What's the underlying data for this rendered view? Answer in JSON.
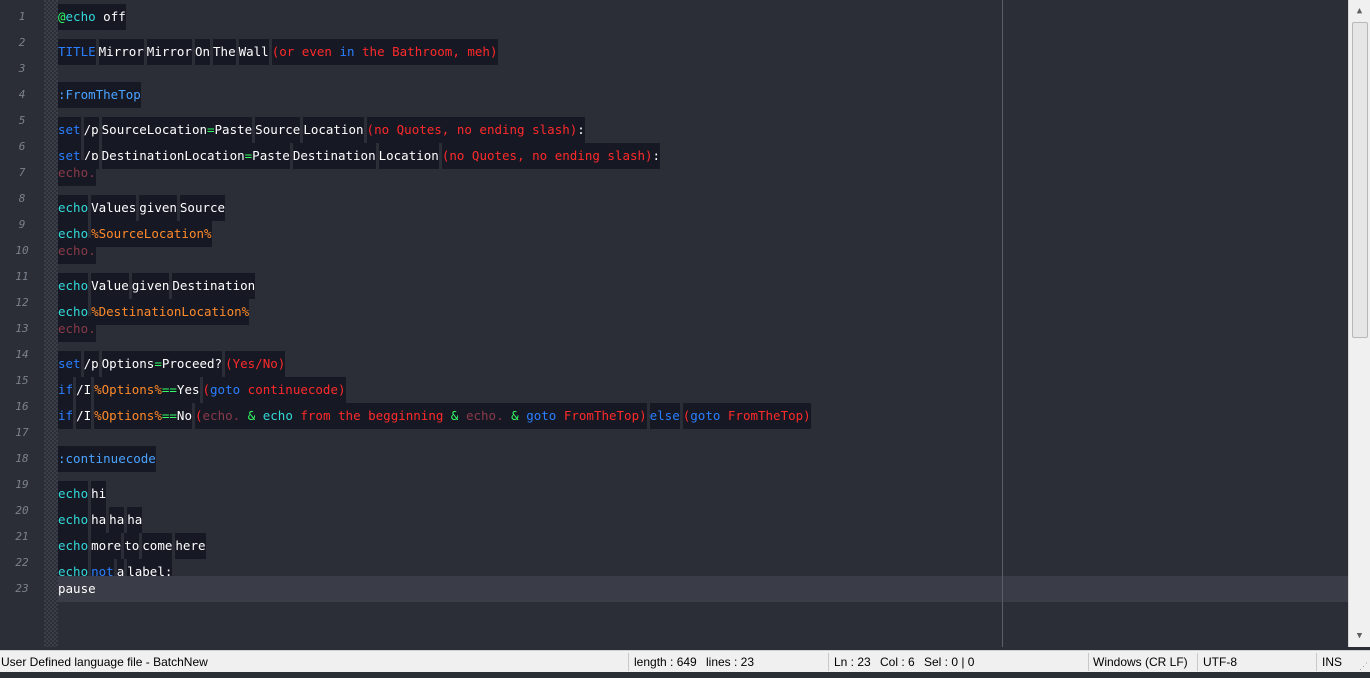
{
  "colors": {
    "background": "#2b2e37",
    "token_background": "#161824",
    "keyword_blue": "#2a7fff",
    "command_cyan": "#33d9d9",
    "string_red": "#ff2a2a",
    "variable_orange": "#ff8a2a",
    "operator_green": "#33ff66",
    "comment_maroon": "#8a3a48",
    "label_blue": "#4aa3ff",
    "text_white": "#ffffff"
  },
  "line_numbers": [
    "1",
    "2",
    "3",
    "4",
    "5",
    "6",
    "7",
    "8",
    "9",
    "10",
    "11",
    "12",
    "13",
    "14",
    "15",
    "16",
    "17",
    "18",
    "19",
    "20",
    "21",
    "22",
    "23"
  ],
  "code_lines": [
    [
      {
        "t": "@",
        "c": "#33ff66"
      },
      {
        "t": "echo",
        "c": "#33d9d9"
      },
      {
        "t": " off",
        "c": "#ffffff"
      }
    ],
    [
      {
        "t": "TITLE",
        "c": "#2a7fff"
      },
      {
        "s": 1
      },
      {
        "t": "Mirror",
        "c": "#ffffff"
      },
      {
        "s": 1
      },
      {
        "t": "Mirror",
        "c": "#ffffff"
      },
      {
        "s": 1
      },
      {
        "t": "On",
        "c": "#ffffff"
      },
      {
        "s": 1
      },
      {
        "t": "The",
        "c": "#ffffff"
      },
      {
        "s": 1
      },
      {
        "t": "Wall",
        "c": "#ffffff"
      },
      {
        "s": 1
      },
      {
        "t": "(or even ",
        "c": "#ff2a2a"
      },
      {
        "t": "in",
        "c": "#2a7fff"
      },
      {
        "t": " the Bathroom, meh)",
        "c": "#ff2a2a"
      }
    ],
    [],
    [
      {
        "t": ":FromTheTop",
        "c": "#4aa3ff"
      }
    ],
    [
      {
        "t": "set",
        "c": "#2a7fff"
      },
      {
        "s": 1
      },
      {
        "t": "/p",
        "c": "#ffffff"
      },
      {
        "s": 1
      },
      {
        "t": "SourceLocation",
        "c": "#ffffff"
      },
      {
        "t": "=",
        "c": "#33ff66"
      },
      {
        "t": "Paste",
        "c": "#ffffff"
      },
      {
        "s": 1
      },
      {
        "t": "Source",
        "c": "#ffffff"
      },
      {
        "s": 1
      },
      {
        "t": "Location",
        "c": "#ffffff"
      },
      {
        "s": 1
      },
      {
        "t": "(no Quotes, no ending slash)",
        "c": "#ff2a2a"
      },
      {
        "t": ":",
        "c": "#ffffff"
      }
    ],
    [
      {
        "t": "set",
        "c": "#2a7fff"
      },
      {
        "s": 1
      },
      {
        "t": "/p",
        "c": "#ffffff"
      },
      {
        "s": 1
      },
      {
        "t": "DestinationLocation",
        "c": "#ffffff"
      },
      {
        "t": "=",
        "c": "#33ff66"
      },
      {
        "t": "Paste",
        "c": "#ffffff"
      },
      {
        "s": 1
      },
      {
        "t": "Destination",
        "c": "#ffffff"
      },
      {
        "s": 1
      },
      {
        "t": "Location",
        "c": "#ffffff"
      },
      {
        "s": 1
      },
      {
        "t": "(no Quotes, no ending slash)",
        "c": "#ff2a2a"
      },
      {
        "t": ":",
        "c": "#ffffff"
      }
    ],
    [
      {
        "t": "echo.",
        "c": "#8a3a48"
      }
    ],
    [
      {
        "t": "echo",
        "c": "#33d9d9"
      },
      {
        "s": 1
      },
      {
        "t": "Values",
        "c": "#ffffff"
      },
      {
        "s": 1
      },
      {
        "t": "given",
        "c": "#ffffff"
      },
      {
        "s": 1
      },
      {
        "t": "Source",
        "c": "#ffffff"
      }
    ],
    [
      {
        "t": "echo",
        "c": "#33d9d9"
      },
      {
        "s": 1
      },
      {
        "t": "%SourceLocation%",
        "c": "#ff8a2a"
      }
    ],
    [
      {
        "t": "echo.",
        "c": "#8a3a48"
      }
    ],
    [
      {
        "t": "echo",
        "c": "#33d9d9"
      },
      {
        "s": 1
      },
      {
        "t": "Value",
        "c": "#ffffff"
      },
      {
        "s": 1
      },
      {
        "t": "given",
        "c": "#ffffff"
      },
      {
        "s": 1
      },
      {
        "t": "Destination",
        "c": "#ffffff"
      }
    ],
    [
      {
        "t": "echo",
        "c": "#33d9d9"
      },
      {
        "s": 1
      },
      {
        "t": "%DestinationLocation%",
        "c": "#ff8a2a"
      }
    ],
    [
      {
        "t": "echo.",
        "c": "#8a3a48"
      }
    ],
    [
      {
        "t": "set",
        "c": "#2a7fff"
      },
      {
        "s": 1
      },
      {
        "t": "/p",
        "c": "#ffffff"
      },
      {
        "s": 1
      },
      {
        "t": "Options",
        "c": "#ffffff"
      },
      {
        "t": "=",
        "c": "#33ff66"
      },
      {
        "t": "Proceed?",
        "c": "#ffffff"
      },
      {
        "s": 1
      },
      {
        "t": "(Yes/No)",
        "c": "#ff2a2a"
      }
    ],
    [
      {
        "t": "if",
        "c": "#2a7fff"
      },
      {
        "s": 1
      },
      {
        "t": "/I",
        "c": "#ffffff"
      },
      {
        "s": 1
      },
      {
        "t": "%Options%",
        "c": "#ff8a2a"
      },
      {
        "t": "==",
        "c": "#33ff66"
      },
      {
        "t": "Yes",
        "c": "#ffffff"
      },
      {
        "s": 1
      },
      {
        "t": "(",
        "c": "#ff2a2a"
      },
      {
        "t": "goto",
        "c": "#2a7fff"
      },
      {
        "t": " continuecode)",
        "c": "#ff2a2a"
      }
    ],
    [
      {
        "t": "if",
        "c": "#2a7fff"
      },
      {
        "s": 1
      },
      {
        "t": "/I",
        "c": "#ffffff"
      },
      {
        "s": 1
      },
      {
        "t": "%Options%",
        "c": "#ff8a2a"
      },
      {
        "t": "==",
        "c": "#33ff66"
      },
      {
        "t": "No",
        "c": "#ffffff"
      },
      {
        "s": 1
      },
      {
        "t": "(",
        "c": "#ff2a2a"
      },
      {
        "t": "echo.",
        "c": "#8a3a48"
      },
      {
        "t": " ",
        "c": "#ffffff"
      },
      {
        "t": "&",
        "c": "#33ff66"
      },
      {
        "t": " ",
        "c": "#ffffff"
      },
      {
        "t": "echo",
        "c": "#33d9d9"
      },
      {
        "t": " from the begginning ",
        "c": "#ff2a2a"
      },
      {
        "t": "&",
        "c": "#33ff66"
      },
      {
        "t": " ",
        "c": "#ffffff"
      },
      {
        "t": "echo.",
        "c": "#8a3a48"
      },
      {
        "t": " ",
        "c": "#ffffff"
      },
      {
        "t": "&",
        "c": "#33ff66"
      },
      {
        "t": " ",
        "c": "#ffffff"
      },
      {
        "t": "goto",
        "c": "#2a7fff"
      },
      {
        "t": " FromTheTop)",
        "c": "#ff2a2a"
      },
      {
        "s": 1
      },
      {
        "t": "else",
        "c": "#2a7fff"
      },
      {
        "s": 1
      },
      {
        "t": "(",
        "c": "#ff2a2a"
      },
      {
        "t": "goto",
        "c": "#2a7fff"
      },
      {
        "t": " FromTheTop)",
        "c": "#ff2a2a"
      }
    ],
    [],
    [
      {
        "t": ":continuecode",
        "c": "#4aa3ff"
      }
    ],
    [
      {
        "t": "echo",
        "c": "#33d9d9"
      },
      {
        "s": 1
      },
      {
        "t": "hi",
        "c": "#ffffff"
      }
    ],
    [
      {
        "t": "echo",
        "c": "#33d9d9"
      },
      {
        "s": 1
      },
      {
        "t": "ha",
        "c": "#ffffff"
      },
      {
        "s": 1
      },
      {
        "t": "ha",
        "c": "#ffffff"
      },
      {
        "s": 1
      },
      {
        "t": "ha",
        "c": "#ffffff"
      }
    ],
    [
      {
        "t": "echo",
        "c": "#33d9d9"
      },
      {
        "s": 1
      },
      {
        "t": "more",
        "c": "#ffffff"
      },
      {
        "s": 1
      },
      {
        "t": "to",
        "c": "#ffffff"
      },
      {
        "s": 1
      },
      {
        "t": "come",
        "c": "#ffffff"
      },
      {
        "s": 1
      },
      {
        "t": "here",
        "c": "#ffffff"
      }
    ],
    [
      {
        "t": "echo",
        "c": "#33d9d9"
      },
      {
        "s": 1
      },
      {
        "t": "not",
        "c": "#2a7fff"
      },
      {
        "s": 1
      },
      {
        "t": "a",
        "c": "#ffffff"
      },
      {
        "s": 1
      },
      {
        "t": "label:",
        "c": "#ffffff"
      }
    ],
    [
      {
        "t": "pause",
        "c": "#ffffff",
        "plain": true
      }
    ]
  ],
  "current_line": 23,
  "status_bar": {
    "language": "User Defined language file - BatchNew",
    "length": "length : 649",
    "lines": "lines : 23",
    "ln": "Ln : 23",
    "col": "Col : 6",
    "sel": "Sel : 0 | 0",
    "eol": "Windows (CR LF)",
    "encoding": "UTF-8",
    "mode": "INS"
  },
  "icons": {
    "scroll_up": "scroll-up-arrow-icon",
    "scroll_down": "scroll-down-arrow-icon",
    "resize_grip": "resize-grip-icon"
  }
}
